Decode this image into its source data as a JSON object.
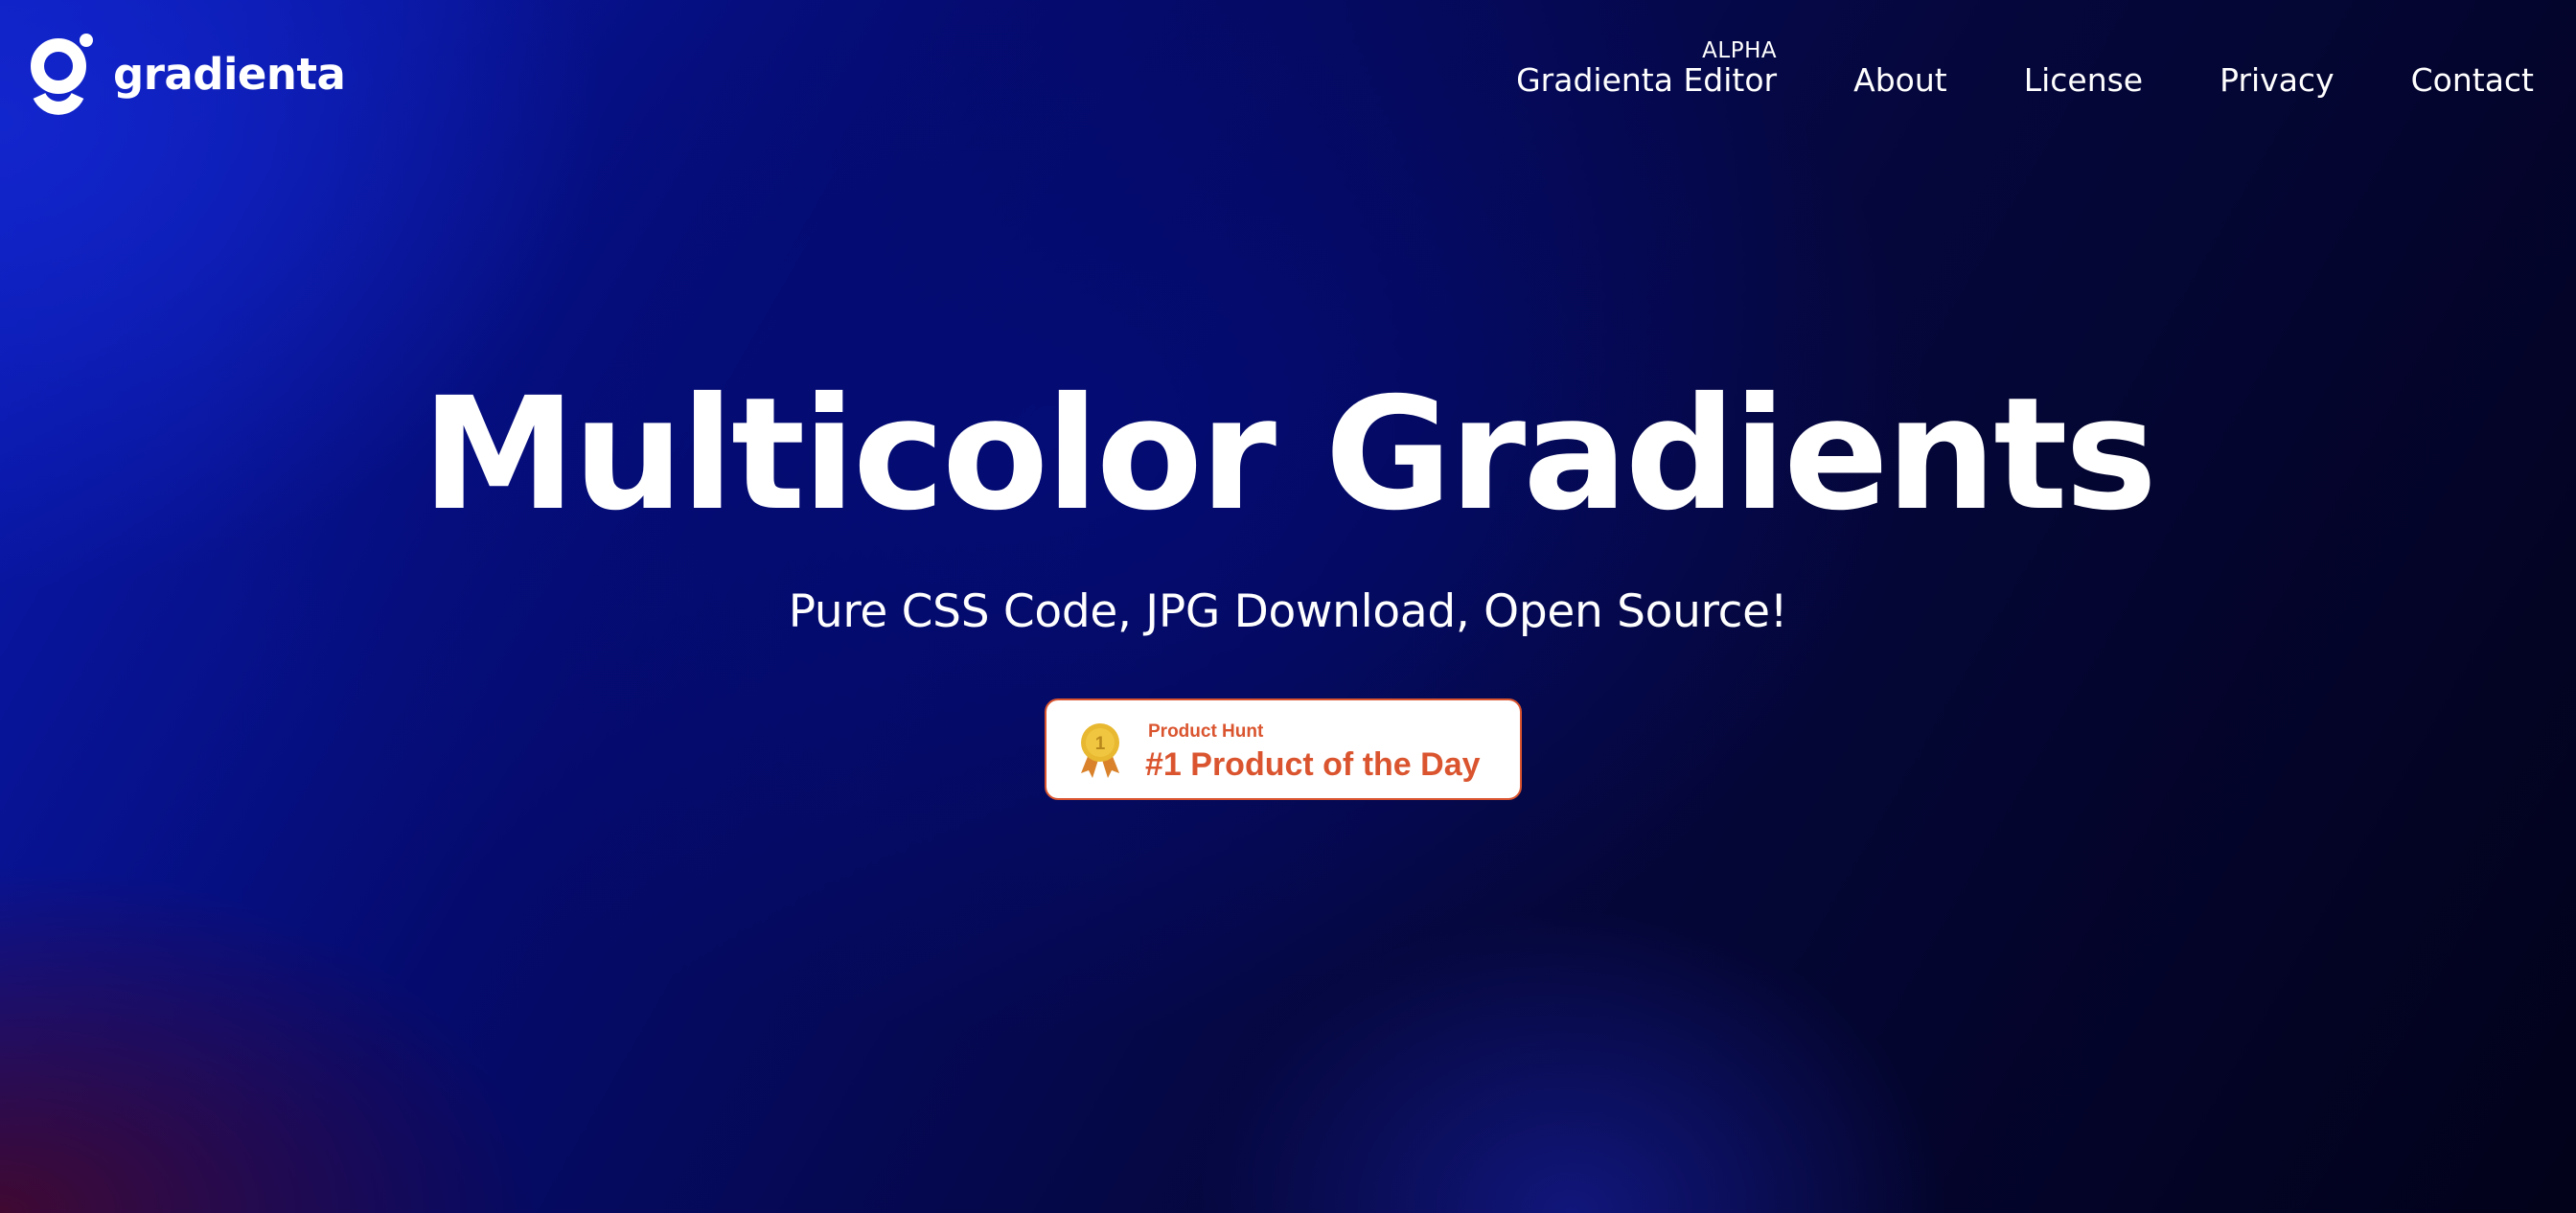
{
  "brand": {
    "name": "gradienta",
    "logo_icon": "gradienta-g-icon"
  },
  "nav": {
    "items": [
      {
        "label": "Gradienta Editor",
        "badge": "ALPHA"
      },
      {
        "label": "About"
      },
      {
        "label": "License"
      },
      {
        "label": "Privacy"
      },
      {
        "label": "Contact"
      }
    ]
  },
  "hero": {
    "title": "Multicolor Gradients",
    "subtitle": "Pure CSS Code, JPG Download, Open Source!"
  },
  "product_hunt": {
    "kicker": "Product Hunt",
    "title": "#1 Product of the Day",
    "medal_number": "1",
    "medal_icon": "gold-medal-icon",
    "accent_color": "#da552f"
  },
  "colors": {
    "background_start": "#0a1bb8",
    "background_end": "#02021a",
    "text": "#ffffff"
  }
}
